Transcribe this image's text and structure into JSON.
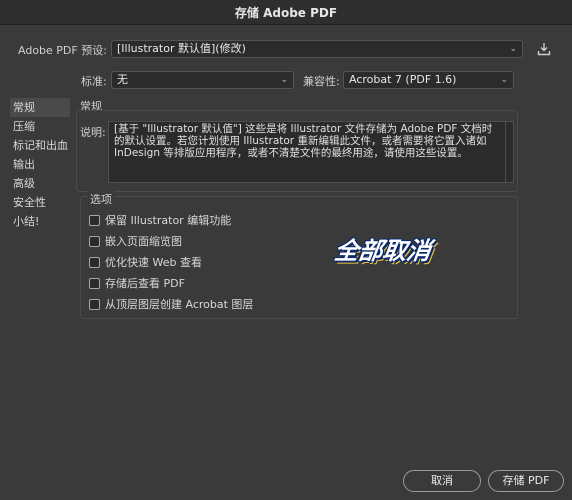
{
  "window": {
    "title": "存储 Adobe PDF"
  },
  "preset": {
    "label": "Adobe PDF 预设:",
    "value": "[Illustrator 默认值](修改)"
  },
  "standard": {
    "label": "标准:",
    "value": "无"
  },
  "compatibility": {
    "label": "兼容性:",
    "value": "Acrobat 7 (PDF 1.6)"
  },
  "sidebar": {
    "items": [
      {
        "label": "常规"
      },
      {
        "label": "压缩"
      },
      {
        "label": "标记和出血"
      },
      {
        "label": "输出"
      },
      {
        "label": "高级"
      },
      {
        "label": "安全性"
      },
      {
        "label": "小结!"
      }
    ]
  },
  "general": {
    "heading": "常规",
    "description_label": "说明:",
    "description": "[基于 \"Illustrator 默认值\"] 这些是将 Illustrator 文件存储为 Adobe PDF 文档时的默认设置。若您计划使用 Illustrator 重新编辑此文件，或者需要将它置入诸如 InDesign 等排版应用程序，或者不清楚文件的最终用途，请使用这些设置。"
  },
  "options": {
    "heading": "选项",
    "items": [
      {
        "label": "保留 Illustrator 编辑功能",
        "checked": false
      },
      {
        "label": "嵌入页面缩览图",
        "checked": false
      },
      {
        "label": "优化快速 Web 查看",
        "checked": false
      },
      {
        "label": "存储后查看 PDF",
        "checked": false
      },
      {
        "label": "从顶层图层创建 Acrobat 图层",
        "checked": false
      }
    ]
  },
  "overlay_text": "全部取消",
  "buttons": {
    "cancel": "取消",
    "save": "存储 PDF"
  },
  "icons": {
    "save_preset": "download-icon"
  }
}
